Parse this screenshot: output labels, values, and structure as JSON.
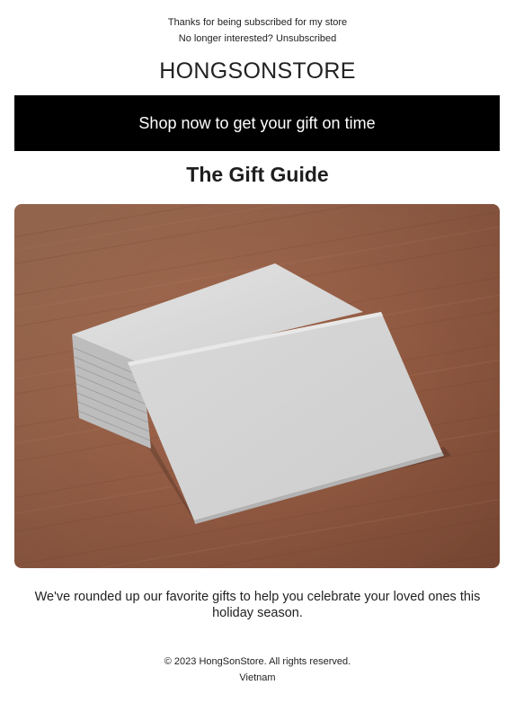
{
  "preheader": {
    "thanks": "Thanks for being subscribed for my store",
    "no_longer": "No longer interested?",
    "unsubscribe_label": "Unsubscribed"
  },
  "header": {
    "store_name": "HONGSONSTORE"
  },
  "banner": {
    "label": "Shop now to get your gift on time"
  },
  "main": {
    "title": "The Gift Guide",
    "hero_image": "blank-business-cards-on-wooden-table",
    "body": "We've rounded up our favorite gifts to help you celebrate your loved ones this holiday season."
  },
  "footer": {
    "copyright": "© 2023 HongSonStore. All rights reserved.",
    "country": "Vietnam"
  },
  "colors": {
    "banner_bg": "#000000",
    "banner_text": "#ffffff",
    "text": "#222222",
    "wood": "#a0664a"
  }
}
